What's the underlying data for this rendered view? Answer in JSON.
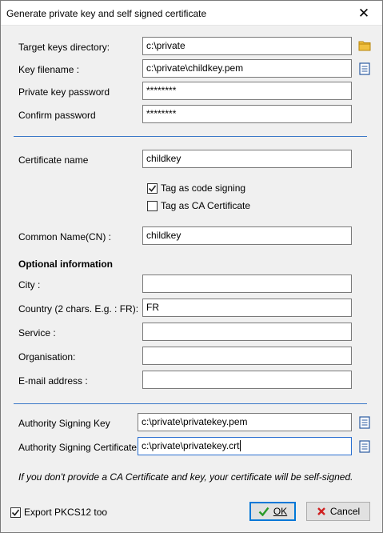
{
  "window": {
    "title": "Generate private key and self signed certificate"
  },
  "keys": {
    "target_dir_label": "Target keys directory:",
    "target_dir_value": "c:\\private",
    "key_filename_label": "Key filename :",
    "key_filename_value": "c:\\private\\childkey.pem",
    "password_label": "Private key password",
    "password_value": "********",
    "confirm_label": "Confirm password",
    "confirm_value": "********"
  },
  "certificate": {
    "name_label": "Certificate name",
    "name_value": "childkey",
    "code_signing_label": "Tag as code signing",
    "code_signing_checked": true,
    "ca_cert_label": "Tag as CA Certificate",
    "ca_cert_checked": false,
    "cn_label": "Common Name(CN) :",
    "cn_value": "childkey"
  },
  "optional": {
    "heading": "Optional information",
    "city_label": "City :",
    "city_value": "",
    "country_label": "Country (2 chars. E.g. : FR):",
    "country_value": "FR",
    "service_label": "Service :",
    "service_value": "",
    "org_label": "Organisation:",
    "org_value": "",
    "email_label": "E-mail address :",
    "email_value": ""
  },
  "authority": {
    "key_label": "Authority Signing Key",
    "key_value": "c:\\private\\privatekey.pem",
    "cert_label": "Authority Signing Certificate",
    "cert_value": "c:\\private\\privatekey.crt"
  },
  "note": "If you don't provide a CA Certificate and key, your certificate will be self-signed.",
  "footer": {
    "export_label": "Export PKCS12 too",
    "export_checked": true,
    "ok_label": "OK",
    "cancel_label": "Cancel"
  },
  "icons": {
    "close": "close-icon",
    "folder": "folder-icon",
    "file": "file-browse-icon",
    "check": "check-icon",
    "cancel": "cancel-x-icon"
  },
  "colors": {
    "accent": "#3a78c8",
    "ok_check": "#2a9a2a",
    "cancel_x": "#d02020",
    "folder": "#e8a820"
  }
}
